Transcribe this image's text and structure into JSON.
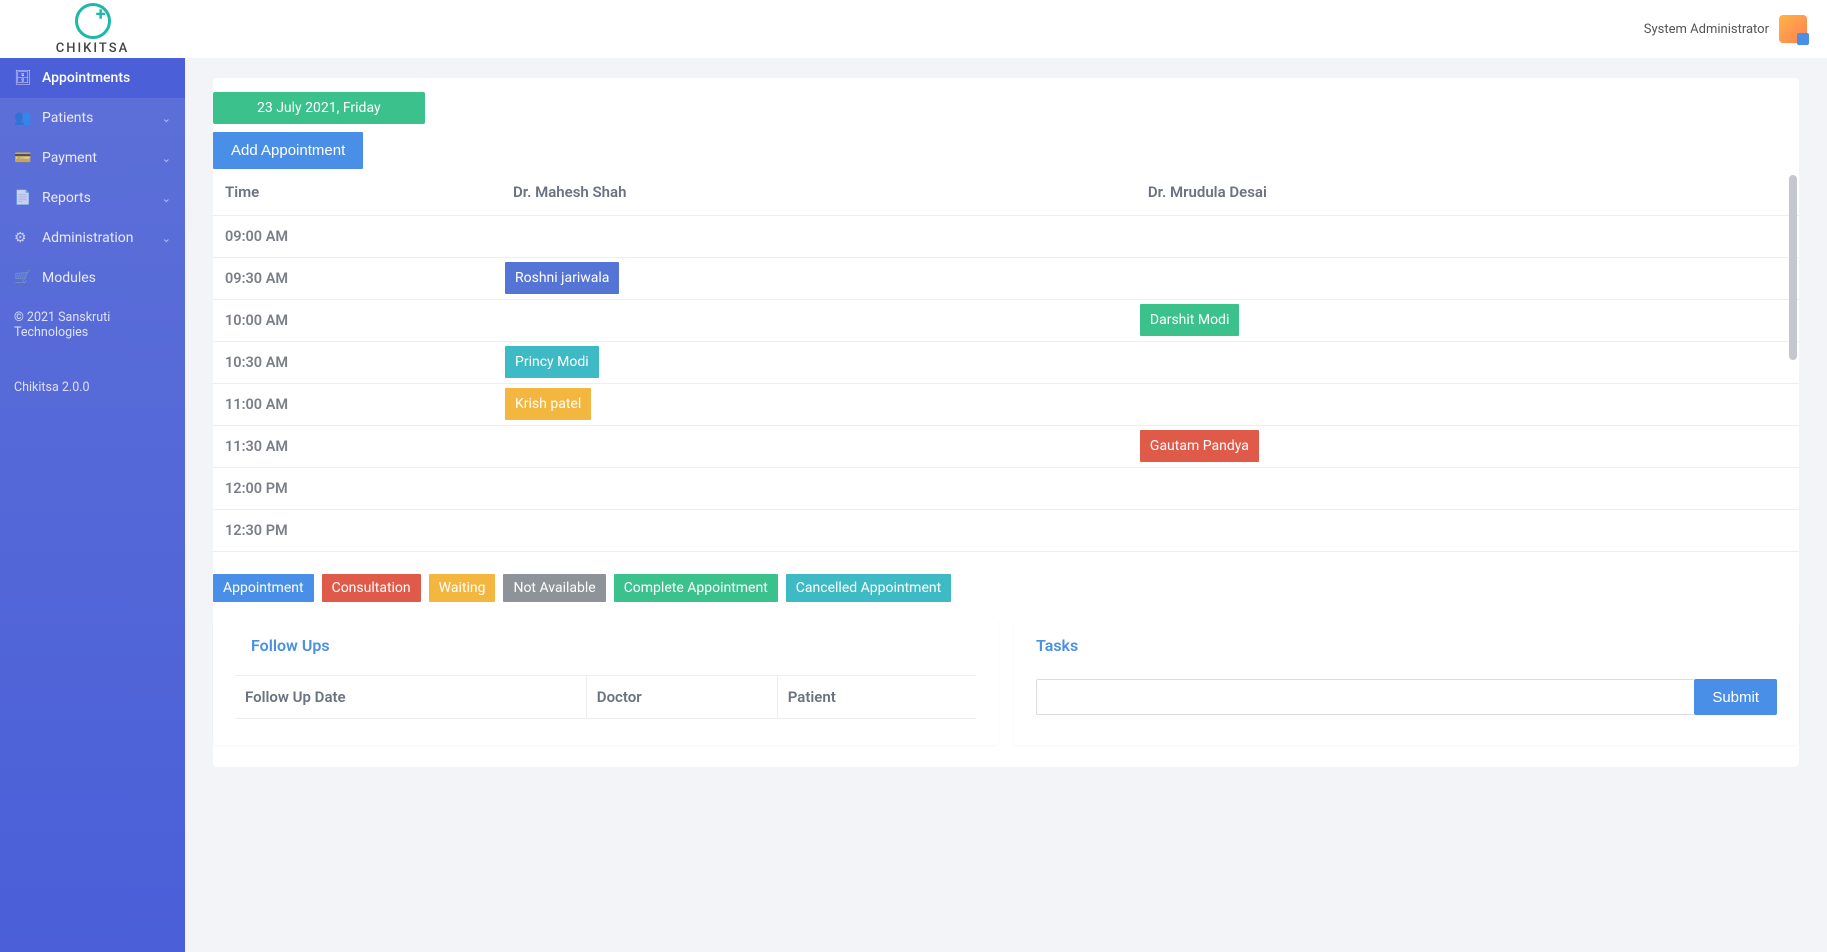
{
  "header": {
    "logo_text": "CHIKITSA",
    "user_label": "System Administrator"
  },
  "sidebar": {
    "items": [
      {
        "label": "Appointments",
        "icon": "briefcase",
        "expandable": false,
        "active": true
      },
      {
        "label": "Patients",
        "icon": "users",
        "expandable": true
      },
      {
        "label": "Payment",
        "icon": "card",
        "expandable": true
      },
      {
        "label": "Reports",
        "icon": "file",
        "expandable": true
      },
      {
        "label": "Administration",
        "icon": "gear",
        "expandable": true
      },
      {
        "label": "Modules",
        "icon": "cart",
        "expandable": false
      }
    ],
    "copyright": "© 2021 Sanskruti Technologies",
    "version": "Chikitsa 2.0.0"
  },
  "schedule": {
    "date_label": "23 July 2021, Friday",
    "add_button": "Add Appointment",
    "columns": [
      "Time",
      "Dr. Mahesh Shah",
      "Dr. Mrudula Desai"
    ],
    "rows": [
      {
        "time": "09:00 AM",
        "c1": null,
        "c2": null
      },
      {
        "time": "09:30 AM",
        "c1": {
          "name": "Roshni jariwala",
          "color": "c-blue"
        },
        "c2": null
      },
      {
        "time": "10:00 AM",
        "c1": null,
        "c2": {
          "name": "Darshit Modi",
          "color": "c-green"
        }
      },
      {
        "time": "10:30 AM",
        "c1": {
          "name": "Princy Modi",
          "color": "c-teal"
        },
        "c2": null
      },
      {
        "time": "11:00 AM",
        "c1": {
          "name": "Krish patel",
          "color": "c-amber"
        },
        "c2": null
      },
      {
        "time": "11:30 AM",
        "c1": null,
        "c2": {
          "name": "Gautam Pandya",
          "color": "c-red"
        }
      },
      {
        "time": "12:00 PM",
        "c1": null,
        "c2": null
      },
      {
        "time": "12:30 PM",
        "c1": null,
        "c2": null
      }
    ]
  },
  "legend": [
    {
      "label": "Appointment",
      "color": "c-blue",
      "bg": "#4a8fe7"
    },
    {
      "label": "Consultation",
      "color": "c-red",
      "bg": "#e05a4a"
    },
    {
      "label": "Waiting",
      "color": "c-amber",
      "bg": "#f3b63f"
    },
    {
      "label": "Not Available",
      "color": "c-gray",
      "bg": "#8e9399"
    },
    {
      "label": "Complete Appointment",
      "color": "c-green",
      "bg": "#3bc18c"
    },
    {
      "label": "Cancelled Appointment",
      "color": "c-teal",
      "bg": "#3ebac4"
    }
  ],
  "followups": {
    "title": "Follow Ups",
    "columns": [
      "Follow Up Date",
      "Doctor",
      "Patient"
    ]
  },
  "tasks": {
    "title": "Tasks",
    "input_value": "",
    "submit_label": "Submit"
  }
}
